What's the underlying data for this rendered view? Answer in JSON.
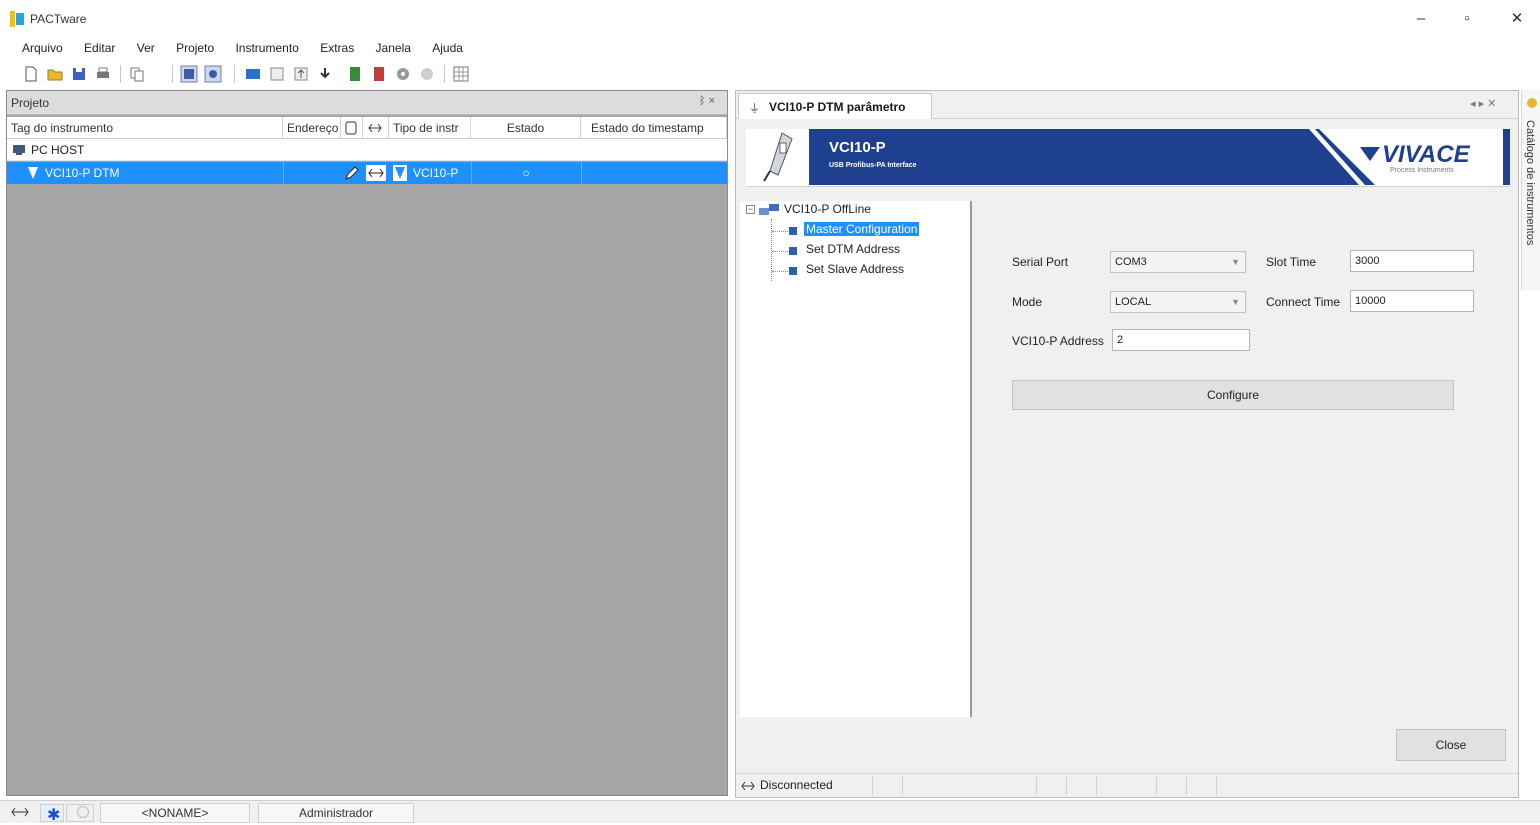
{
  "window": {
    "title": "PACTware",
    "minimize": "–",
    "maximize": "▫",
    "close": "✕"
  },
  "menu": [
    "Arquivo",
    "Editar",
    "Ver",
    "Projeto",
    "Instrumento",
    "Extras",
    "Janela",
    "Ajuda"
  ],
  "project_pane": {
    "title": "Projeto",
    "pin": "ᛒ ×",
    "columns": {
      "tag": "Tag do instrumento",
      "address": "Endereço",
      "type": "Tipo de instr",
      "state": "Estado",
      "timestamp": "Estado do timestamp"
    },
    "rows": [
      {
        "tag": "PC HOST",
        "type": "",
        "state": ""
      },
      {
        "tag": "VCI10-P DTM",
        "type": "VCI10-P",
        "state": "○"
      }
    ]
  },
  "dtm": {
    "tab_title": "VCI10-P DTM parâmetro",
    "tab_controls": "◂ ▸ ✕",
    "banner_title": "VCI10-P",
    "banner_subtitle": "USB Profibus-PA Interface",
    "brand": "VIVACE",
    "brand_sub": "Process Instruments",
    "tree": {
      "root": "VCI10-P OffLine",
      "items": [
        "Master Configuration",
        "Set DTM Address",
        "Set Slave Address"
      ],
      "selected_index": 0
    },
    "form": {
      "serial_port_label": "Serial Port",
      "serial_port_value": "COM3",
      "mode_label": "Mode",
      "mode_value": "LOCAL",
      "slot_time_label": "Slot Time",
      "slot_time_value": "3000",
      "connect_time_label": "Connect Time",
      "connect_time_value": "10000",
      "address_label": "VCI10-P Address",
      "address_value": "2",
      "configure_button": "Configure",
      "close_button": "Close"
    },
    "status": "Disconnected"
  },
  "side_panel": {
    "label": "Catálogo de instrumentos"
  },
  "statusbar": {
    "project_name": "<NONAME>",
    "user": "Administrador"
  },
  "colors": {
    "selection": "#1e90ff",
    "banner": "#1f3f8f",
    "pane_bg": "#a6a6a6"
  }
}
